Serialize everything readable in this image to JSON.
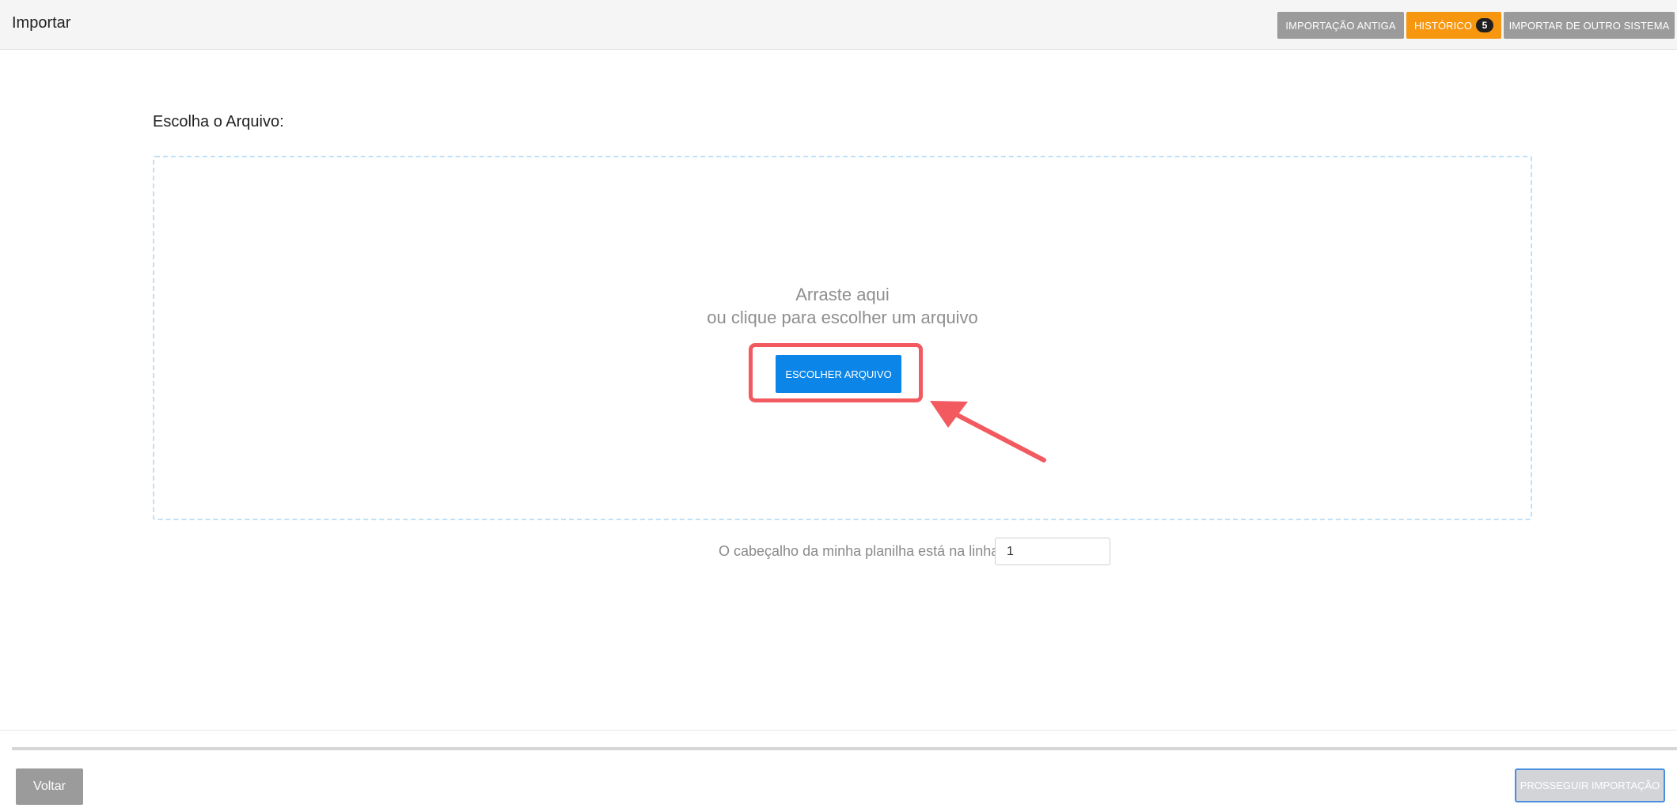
{
  "header": {
    "title": "Importar",
    "buttons": {
      "old_import": "IMPORTAÇÃO ANTIGA",
      "history": "HISTÓRICO",
      "history_count": "5",
      "other_system": "IMPORTAR DE OUTRO SISTEMA"
    }
  },
  "upload": {
    "label": "Escolha o Arquivo:",
    "drag_text": "Arraste aqui",
    "click_text": "ou clique para escolher um arquivo",
    "choose_button": "ESCOLHER ARQUIVO"
  },
  "header_row": {
    "label": "O cabeçalho da minha planilha está na linha",
    "value": "1"
  },
  "footer": {
    "back_button": "Voltar",
    "proceed_button": "PROSSEGUIR IMPORTAÇÃO"
  },
  "colors": {
    "accent_orange": "#f7960f",
    "primary_blue": "#0b86e8",
    "gray_button": "#9b9b9b",
    "annotation_red": "#f25a5f"
  }
}
